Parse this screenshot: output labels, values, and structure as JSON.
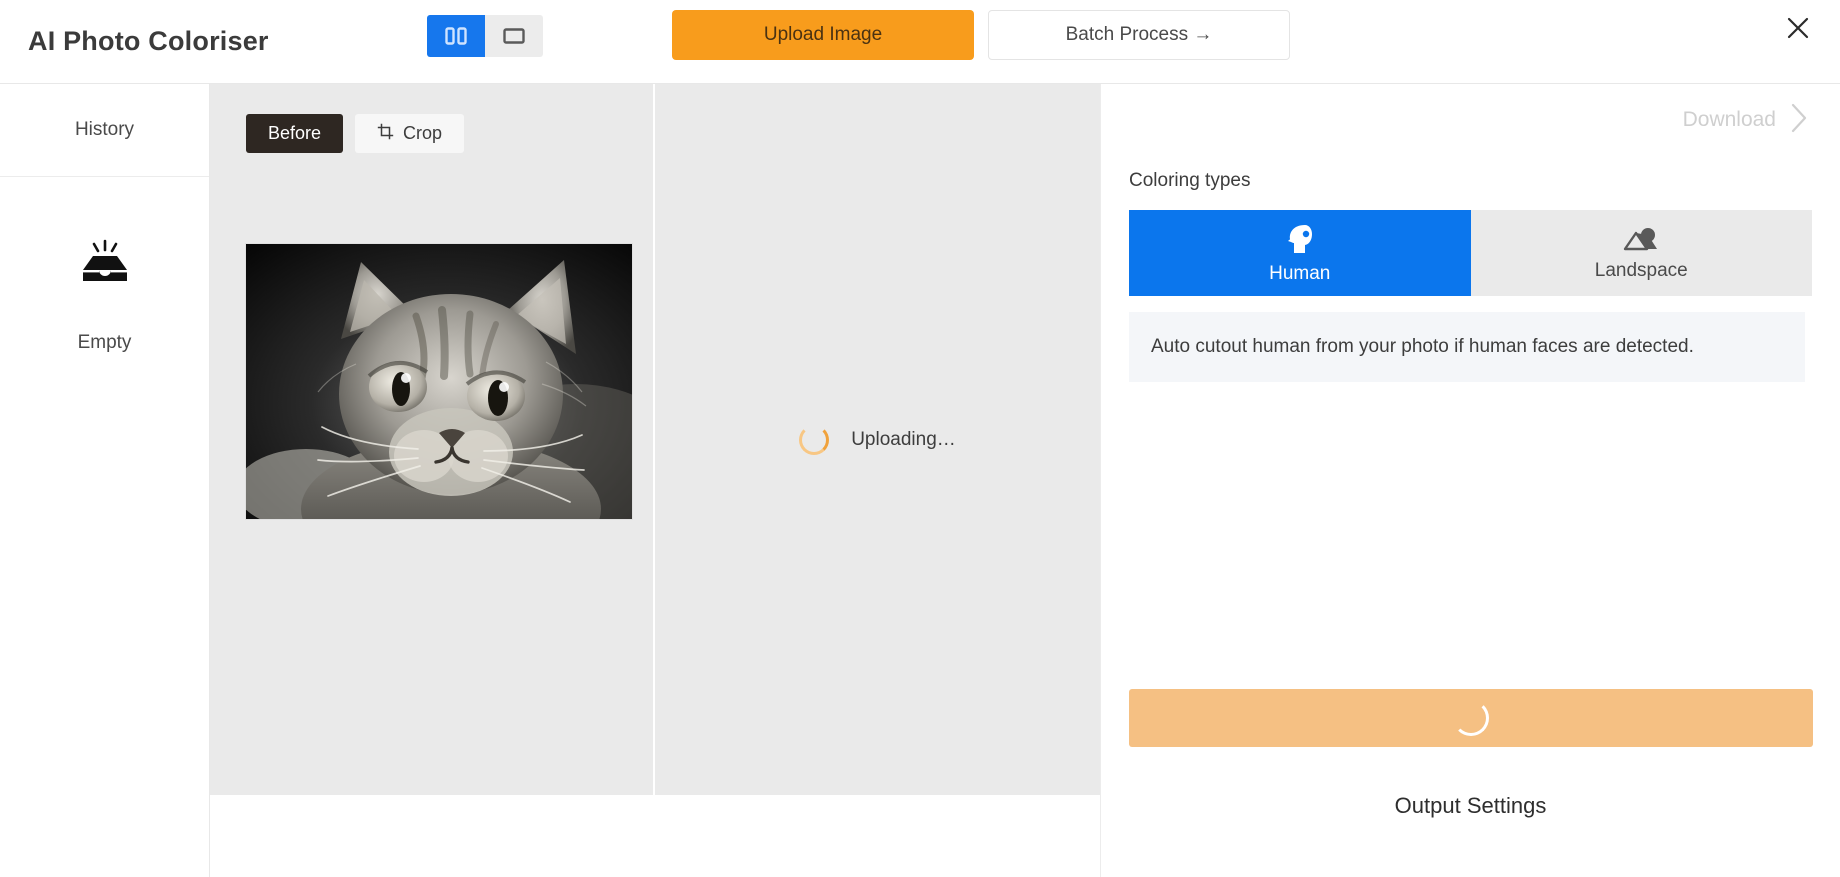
{
  "header": {
    "app_title": "AI Photo Coloriser",
    "view_toggle": {
      "split_view_icon": "split-view-icon",
      "single_view_icon": "single-view-icon",
      "active": "split"
    },
    "upload_label": "Upload Image",
    "batch_label": "Batch Process →",
    "close_icon": "close-icon"
  },
  "sidebar": {
    "history_label": "History",
    "empty_icon": "empty-tray-icon",
    "empty_label": "Empty"
  },
  "canvas": {
    "tabs": [
      {
        "label": "Before",
        "active": true,
        "icon": null
      },
      {
        "label": "Crop",
        "active": false,
        "icon": "crop-icon"
      }
    ],
    "photo_alt": "black-and-white tabby cat portrait",
    "uploading_text": "Uploading…",
    "spinner_icon": "loading-spinner-icon"
  },
  "right_panel": {
    "download_label": "Download",
    "download_enabled": false,
    "download_chevron_icon": "chevron-right-icon",
    "coloring_types_label": "Coloring types",
    "types": [
      {
        "label": "Human",
        "icon": "human-head-icon",
        "selected": true
      },
      {
        "label": "Landspace",
        "icon": "landscape-mountain-icon",
        "selected": false
      }
    ],
    "type_description": "Auto cutout human from your photo if human faces are detected.",
    "action_button": {
      "state": "loading",
      "icon": "loading-spinner-icon"
    },
    "output_settings_label": "Output Settings"
  },
  "colors": {
    "accent_orange": "#f89c1c",
    "accent_orange_disabled": "#f5c083",
    "accent_blue": "#0b76ed",
    "toggle_blue": "#1677ed",
    "dark_tab": "#2e2722",
    "canvas_grey": "#eaeaea",
    "desc_bg": "#f4f6f9",
    "disabled_text": "#cfcfcf"
  }
}
